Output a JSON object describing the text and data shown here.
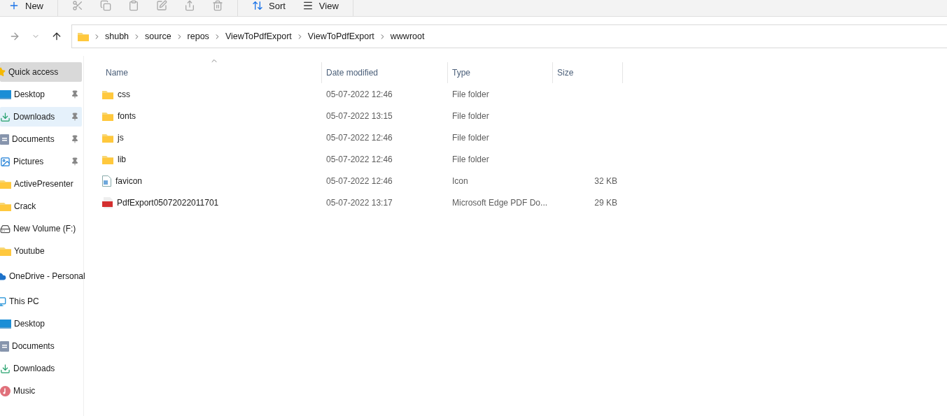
{
  "toolbar": {
    "items": [
      {
        "kind": "new",
        "label": "New"
      },
      {
        "kind": "cut"
      },
      {
        "kind": "copy"
      },
      {
        "kind": "paste"
      },
      {
        "kind": "rename"
      },
      {
        "kind": "share"
      },
      {
        "kind": "delete"
      },
      {
        "kind": "sort",
        "label": "Sort"
      },
      {
        "kind": "view",
        "label": "View"
      }
    ]
  },
  "navigation": {
    "forward_enabled": false
  },
  "address_bar": {
    "segments": [
      "shubh",
      "source",
      "repos",
      "ViewToPdfExport",
      "ViewToPdfExport",
      "wwwroot"
    ]
  },
  "sidebar": {
    "items": [
      {
        "label": "Quick access",
        "kind": "star",
        "selected": true,
        "hovered": false,
        "children": [
          {
            "label": "Desktop",
            "kind": "desktop",
            "pinned": true,
            "selected": false,
            "hovered": false
          },
          {
            "label": "Downloads",
            "kind": "download",
            "pinned": true,
            "selected": false,
            "hovered": true
          },
          {
            "label": "Documents",
            "kind": "document",
            "pinned": true,
            "selected": false,
            "hovered": false
          },
          {
            "label": "Pictures",
            "kind": "pictures",
            "pinned": true,
            "selected": false,
            "hovered": false
          },
          {
            "label": "ActivePresenter",
            "kind": "folder",
            "pinned": false,
            "selected": false,
            "hovered": false
          },
          {
            "label": "Crack",
            "kind": "folder",
            "pinned": false,
            "selected": false,
            "hovered": false
          },
          {
            "label": "New Volume (F:)",
            "kind": "drive",
            "pinned": false,
            "selected": false,
            "hovered": false
          },
          {
            "label": "Youtube",
            "kind": "folder",
            "pinned": false,
            "selected": false,
            "hovered": false
          }
        ]
      },
      {
        "label": "OneDrive - Personal",
        "kind": "cloud",
        "selected": false,
        "hovered": false
      },
      {
        "label": "This PC",
        "kind": "pc",
        "selected": false,
        "hovered": false,
        "children": [
          {
            "label": "Desktop",
            "kind": "desktop",
            "pinned": false,
            "selected": false,
            "hovered": false
          },
          {
            "label": "Documents",
            "kind": "document",
            "pinned": false,
            "selected": false,
            "hovered": false
          },
          {
            "label": "Downloads",
            "kind": "download",
            "pinned": false,
            "selected": false,
            "hovered": false
          },
          {
            "label": "Music",
            "kind": "music",
            "pinned": false,
            "selected": false,
            "hovered": false
          }
        ]
      }
    ]
  },
  "table": {
    "columns": [
      {
        "label": "Name",
        "sorted": true
      },
      {
        "label": "Date modified",
        "sorted": false
      },
      {
        "label": "Type",
        "sorted": false
      },
      {
        "label": "Size",
        "sorted": false
      }
    ],
    "rows": [
      {
        "kind": "folder",
        "name": "css",
        "date": "05-07-2022 12:46",
        "type": "File folder"
      },
      {
        "kind": "folder",
        "name": "fonts",
        "date": "05-07-2022 13:15",
        "type": "File folder"
      },
      {
        "kind": "folder",
        "name": "js",
        "date": "05-07-2022 12:46",
        "type": "File folder"
      },
      {
        "kind": "folder",
        "name": "lib",
        "date": "05-07-2022 12:46",
        "type": "File folder"
      },
      {
        "kind": "icon",
        "name": "favicon",
        "date": "05-07-2022 12:46",
        "type": "Icon",
        "size": "32 KB"
      },
      {
        "kind": "pdf",
        "name": "PdfExport05072022011701",
        "date": "05-07-2022 13:17",
        "type": "Microsoft Edge PDF Do...",
        "size": "29 KB"
      }
    ]
  }
}
